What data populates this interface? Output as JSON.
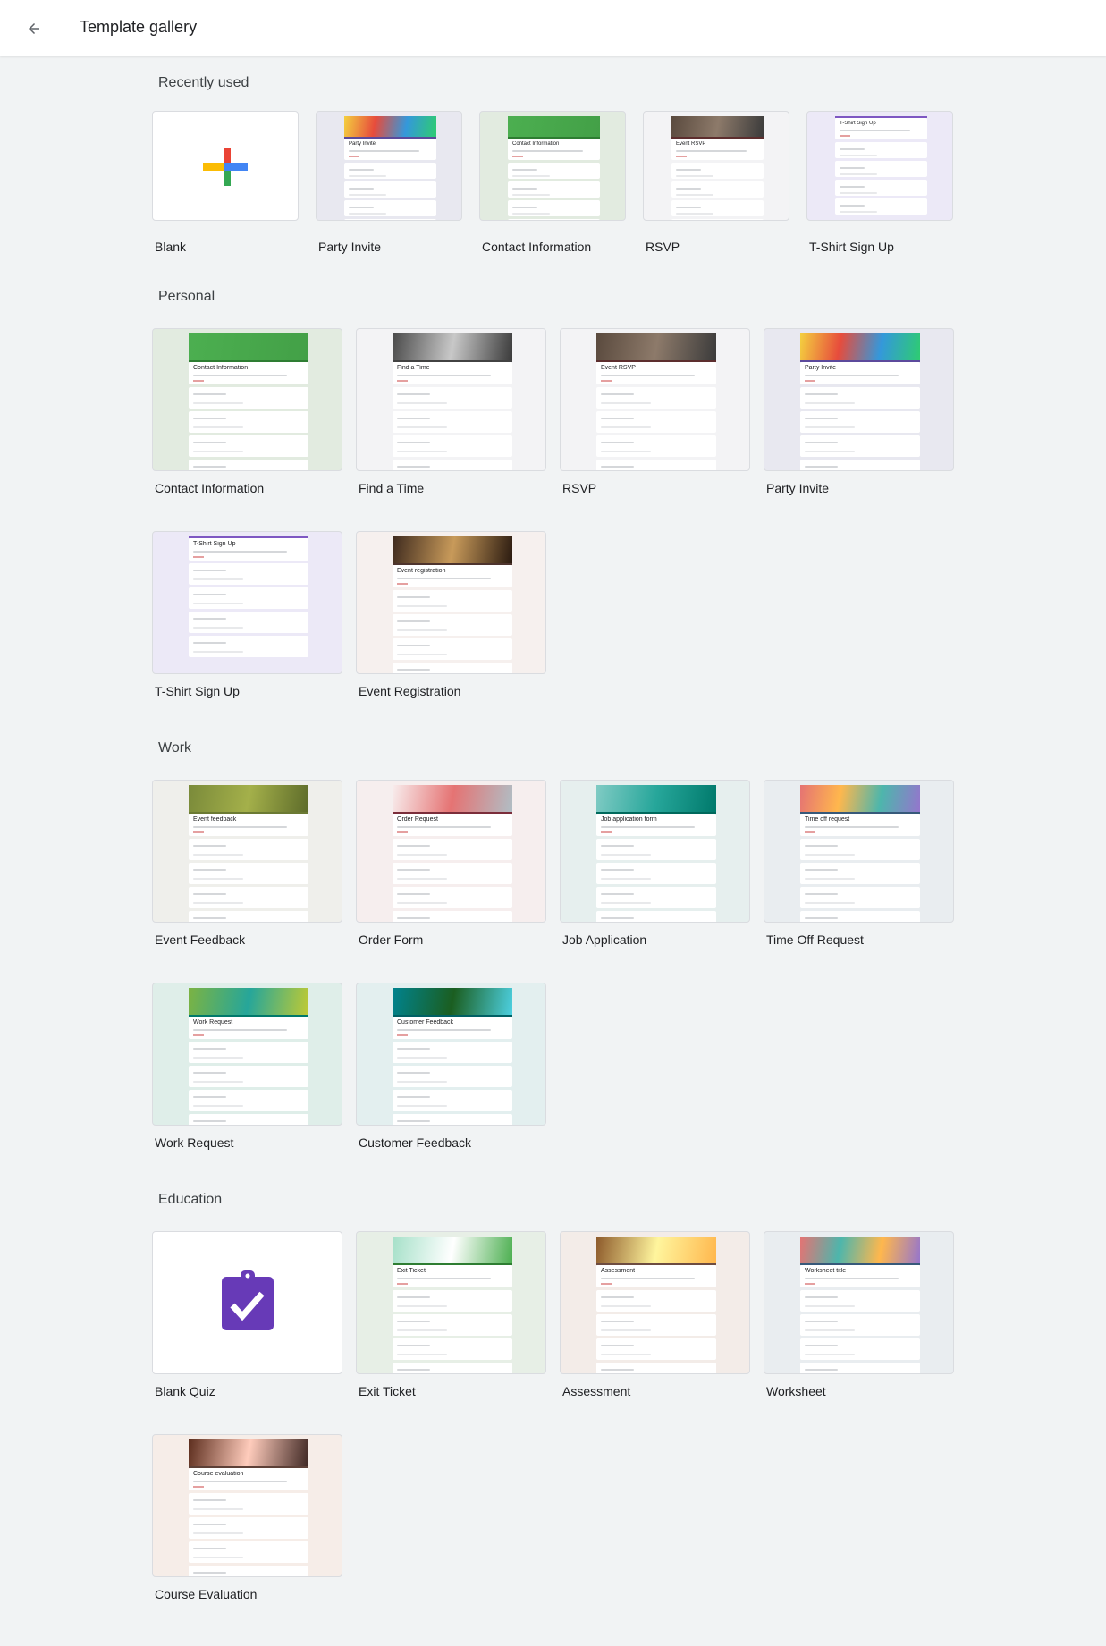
{
  "header": {
    "title": "Template gallery",
    "back_icon": "arrow-back-icon"
  },
  "colors": {
    "page_bg": "#f1f3f4",
    "plus": [
      "#ea4335",
      "#4285f4",
      "#34a853",
      "#fbbc04"
    ],
    "quiz": "#673ab7"
  },
  "sections": [
    {
      "title": "Recently used",
      "size": "small",
      "items": [
        {
          "label": "Blank",
          "kind": "blank"
        },
        {
          "label": "Party Invite",
          "form_title": "Party Invite",
          "bg": "#e8e8f0",
          "banner": [
            "#f4d03f",
            "#e74c3c",
            "#3498db",
            "#2ecc71"
          ],
          "accent": "#5c4a9c"
        },
        {
          "label": "Contact Information",
          "form_title": "Contact Information",
          "bg": "#e2ebe0",
          "banner": [
            "#4caf50",
            "#43a047"
          ],
          "accent": "#2e7d32"
        },
        {
          "label": "RSVP",
          "form_title": "Event RSVP",
          "bg": "#f3f3f5",
          "banner": [
            "#5a4a3e",
            "#8d7a6a",
            "#3b3b3b"
          ],
          "accent": "#5d2e2e"
        },
        {
          "label": "T-Shirt Sign Up",
          "form_title": "T-Shirt Sign Up",
          "bg": "#ece9f7",
          "banner": [],
          "accent": "#7e57c2"
        }
      ]
    },
    {
      "title": "Personal",
      "size": "large",
      "items": [
        {
          "label": "Contact Information",
          "form_title": "Contact Information",
          "bg": "#e2ebe0",
          "banner": [
            "#4caf50",
            "#43a047"
          ],
          "accent": "#2e7d32"
        },
        {
          "label": "Find a Time",
          "form_title": "Find a Time",
          "bg": "#f3f3f5",
          "banner": [
            "#4a4a4a",
            "#c8c8c8",
            "#3a3a3a"
          ],
          "accent": "#424242"
        },
        {
          "label": "RSVP",
          "form_title": "Event RSVP",
          "bg": "#f3f3f5",
          "banner": [
            "#5a4a3e",
            "#8d7a6a",
            "#3b3b3b"
          ],
          "accent": "#5d2e2e"
        },
        {
          "label": "Party Invite",
          "form_title": "Party Invite",
          "bg": "#e8e8f0",
          "banner": [
            "#f4d03f",
            "#e74c3c",
            "#3498db",
            "#2ecc71"
          ],
          "accent": "#5c4a9c"
        },
        {
          "label": "T-Shirt Sign Up",
          "form_title": "T-Shirt Sign Up",
          "bg": "#ece9f7",
          "banner": [],
          "accent": "#7e57c2"
        },
        {
          "label": "Event Registration",
          "form_title": "Event registration",
          "bg": "#f6f0ee",
          "banner": [
            "#3e2a1e",
            "#c89a5a",
            "#2a1a10"
          ],
          "accent": "#4e342e"
        }
      ]
    },
    {
      "title": "Work",
      "size": "large",
      "items": [
        {
          "label": "Event Feedback",
          "form_title": "Event feedback",
          "bg": "#efefeb",
          "banner": [
            "#7a8a3a",
            "#a4b04a",
            "#5d6b2a"
          ],
          "accent": "#6b7a33"
        },
        {
          "label": "Order Form",
          "form_title": "Order Request",
          "bg": "#f6eeee",
          "banner": [
            "#f8eded",
            "#e57373",
            "#b0bec5"
          ],
          "accent": "#7b2d3a"
        },
        {
          "label": "Job Application",
          "form_title": "Job application form",
          "bg": "#e6efee",
          "banner": [
            "#80cbc4",
            "#26a69a",
            "#00796b"
          ],
          "accent": "#00695c"
        },
        {
          "label": "Time Off Request",
          "form_title": "Time off request",
          "bg": "#e9edf0",
          "banner": [
            "#e57373",
            "#ffb74d",
            "#4db6ac",
            "#9575cd"
          ],
          "accent": "#37597a"
        },
        {
          "label": "Work Request",
          "form_title": "Work Request",
          "bg": "#dfeee9",
          "banner": [
            "#7cb342",
            "#26a69a",
            "#c0ca33"
          ],
          "accent": "#00796b"
        },
        {
          "label": "Customer Feedback",
          "form_title": "Customer Feedback",
          "bg": "#e3efef",
          "banner": [
            "#00838f",
            "#1b5e20",
            "#4dd0e1"
          ],
          "accent": "#006064"
        }
      ]
    },
    {
      "title": "Education",
      "size": "large",
      "items": [
        {
          "label": "Blank Quiz",
          "kind": "quiz"
        },
        {
          "label": "Exit Ticket",
          "form_title": "Exit Ticket",
          "bg": "#e7efe6",
          "banner": [
            "#a5e0c8",
            "#ffffff",
            "#4caf50"
          ],
          "accent": "#2e7d32"
        },
        {
          "label": "Assessment",
          "form_title": "Assessment",
          "bg": "#f3ece8",
          "banner": [
            "#8d5a2b",
            "#fff59d",
            "#ffb74d"
          ],
          "accent": "#6d4c41"
        },
        {
          "label": "Worksheet",
          "form_title": "Worksheet title",
          "bg": "#e9edf0",
          "banner": [
            "#e57373",
            "#4db6ac",
            "#ffb74d",
            "#9575cd"
          ],
          "accent": "#37597a"
        },
        {
          "label": "Course Evaluation",
          "form_title": "Course evaluation",
          "bg": "#f6ede8",
          "banner": [
            "#5d2e1e",
            "#ffccbc",
            "#3e2723"
          ],
          "accent": "#5d4037"
        }
      ]
    }
  ]
}
